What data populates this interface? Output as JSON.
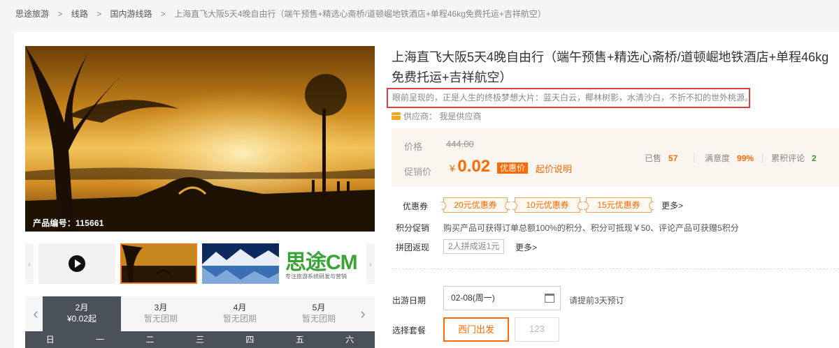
{
  "breadcrumb": {
    "home": "思途旅游",
    "sep1": ">",
    "level1": "线路",
    "sep2": ">",
    "level2": "国内游线路",
    "sep3": ">",
    "current": "上海直飞大阪5天4晚自由行（端午预售+精选心斋桥/道顿崛地铁酒店+单程46kg免费托运+吉祥航空）"
  },
  "gallery": {
    "product_code": "产品编号：115661",
    "prev": "‹",
    "next": "›",
    "logo_text": "思途CM",
    "logo_subtext": "专注旅游系统研发与营销"
  },
  "calendar": {
    "prev": "‹",
    "next": "›",
    "months": [
      {
        "month": "2月",
        "status": "¥0.02起"
      },
      {
        "month": "3月",
        "status": "暂无团期"
      },
      {
        "month": "4月",
        "status": "暂无团期"
      },
      {
        "month": "5月",
        "status": "暂无团期"
      }
    ],
    "weekdays": [
      "日",
      "一",
      "二",
      "三",
      "四",
      "五",
      "六"
    ]
  },
  "product": {
    "title": "上海直飞大阪5天4晚自由行（端午预售+精选心斋桥/道顿崛地铁酒店+单程46kg免费托运+吉祥航空）",
    "subtitle": "眼前呈现的，正是人生的终极梦想大片：蓝天白云，椰林树影，水清沙白，不折不扣的世外桃源。",
    "supplier_label": "供应商：",
    "supplier_name": "我是供应商"
  },
  "price": {
    "price_label": "价格",
    "original": "444.00",
    "promo_label": "促销价",
    "currency": "¥",
    "promo": "0.02",
    "discount_badge": "优惠价",
    "start_note": "起价说明",
    "sold_label": "已售",
    "sold": "57",
    "satisfaction_label": "满意度",
    "satisfaction": "99%",
    "reviews_label": "累积评论",
    "reviews": "2"
  },
  "promotions": {
    "coupon_label": "优惠券",
    "coupons": [
      "20元优惠券",
      "10元优惠券",
      "15元优惠券"
    ],
    "more": "更多>",
    "points_label": "积分促销",
    "points_text": "购买产品可获得订单总额100%的积分、积分可抵现￥50、评论产品可获赠5积分",
    "group_label": "拼团返现",
    "group_tag": "2人拼成返1元",
    "group_more": "更多>"
  },
  "booking": {
    "date_label": "出游日期",
    "date_value": "02-08(周一)",
    "advance_note": "请提前3天预订",
    "package_label": "选择套餐",
    "packages": [
      "西门出发",
      "123"
    ]
  },
  "colors": {
    "accent": "#ff6a00",
    "highlight_border": "#e03f3f",
    "dark_tab": "#4a5159"
  }
}
